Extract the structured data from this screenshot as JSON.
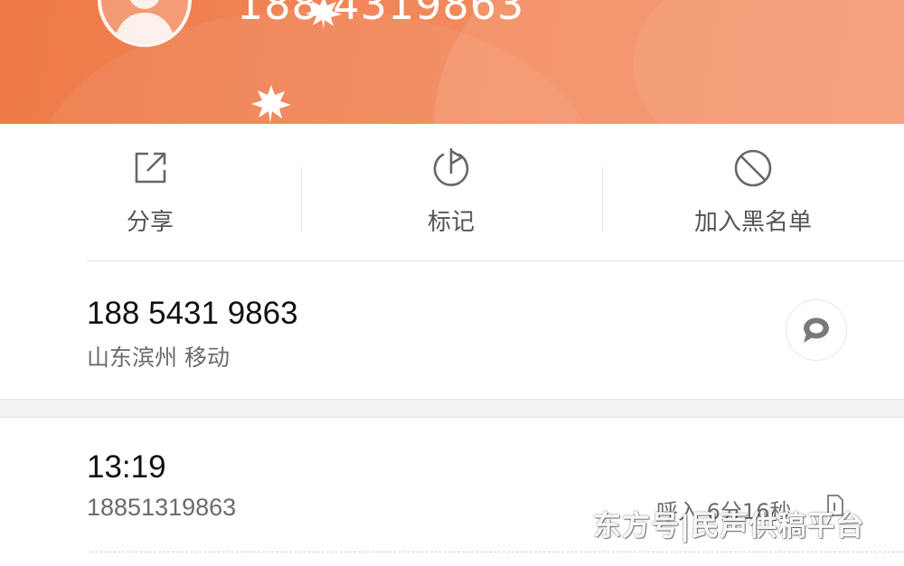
{
  "header": {
    "phone_number": "188 4319863",
    "colors": {
      "gradient_start": "#ee7a47",
      "gradient_end": "#f5936a"
    }
  },
  "actions": [
    {
      "label": "分享",
      "icon": "share-icon"
    },
    {
      "label": "标记",
      "icon": "flag-icon"
    },
    {
      "label": "加入黑名单",
      "icon": "block-icon"
    }
  ],
  "contact": {
    "number": "188 5431 9863",
    "location": "山东滨州 移动",
    "message_icon": "message-bubble-icon"
  },
  "call_record": {
    "time": "13:19",
    "number": "18851319863",
    "info": "呼入 6分16秒"
  },
  "watermark": "东方号|民声供稿平台"
}
